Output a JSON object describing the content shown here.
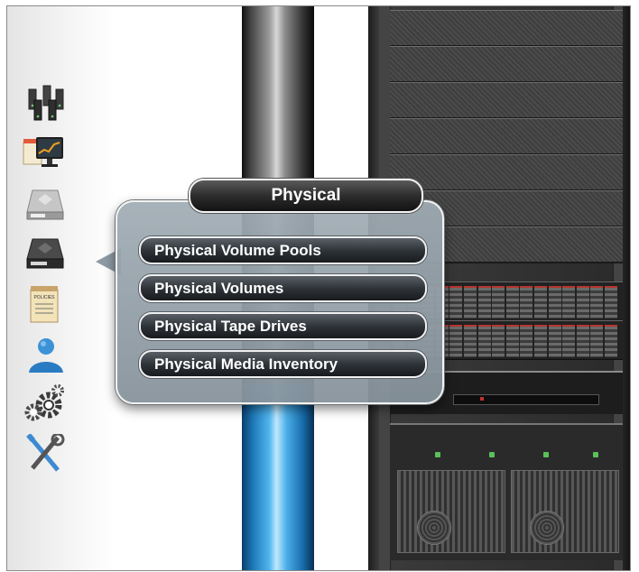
{
  "popup": {
    "title": "Physical",
    "items": [
      {
        "label": "Physical Volume Pools"
      },
      {
        "label": "Physical Volumes"
      },
      {
        "label": "Physical Tape Drives"
      },
      {
        "label": "Physical Media Inventory"
      }
    ]
  },
  "sidebar": {
    "icons": [
      {
        "icon": "servers-icon"
      },
      {
        "icon": "monitoring-icon"
      },
      {
        "icon": "virtual-storage-icon"
      },
      {
        "icon": "physical-storage-icon"
      },
      {
        "icon": "policies-icon",
        "label": "POLICIES"
      },
      {
        "icon": "user-icon"
      },
      {
        "icon": "gears-icon"
      },
      {
        "icon": "tools-icon"
      }
    ]
  },
  "colors": {
    "popup_bg": "#8d9aa3",
    "button_dark": "#2f3439",
    "pole_blue": "#52b6ee",
    "rack": "#3b3b3b"
  }
}
